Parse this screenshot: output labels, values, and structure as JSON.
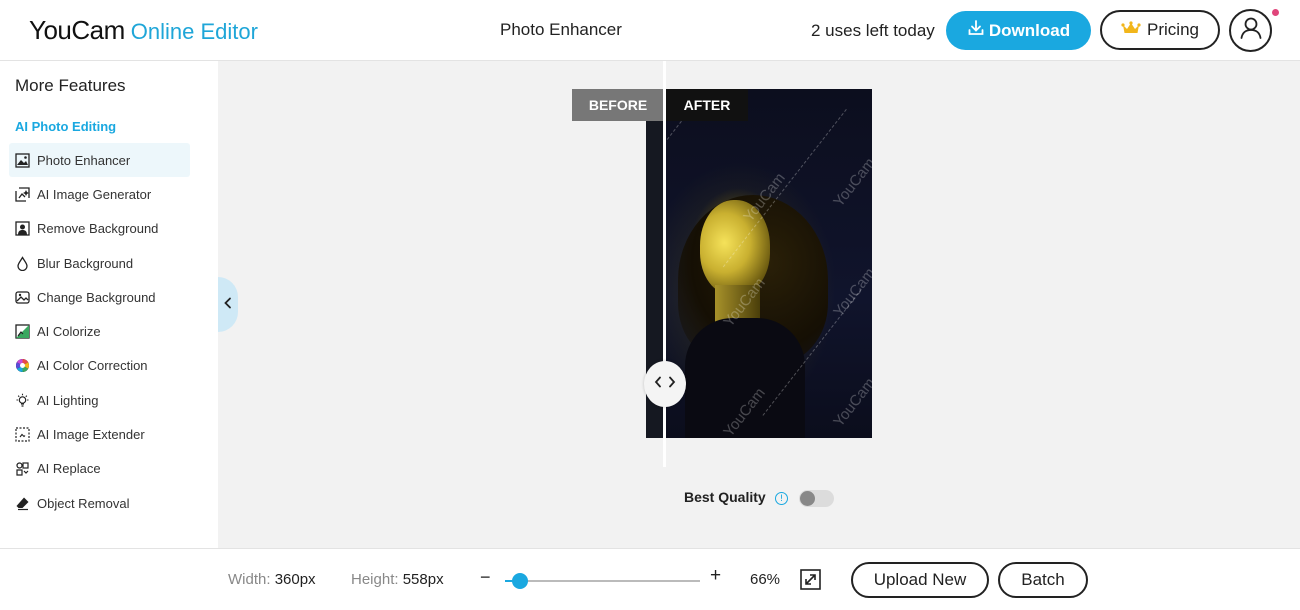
{
  "header": {
    "logo_brand": "YouCam",
    "logo_product": "Online Editor",
    "page_title": "Photo Enhancer",
    "uses_left": "2 uses left today",
    "download_label": "Download",
    "pricing_label": "Pricing",
    "notification_dot_color": "#e0457b"
  },
  "sidebar": {
    "title": "More Features",
    "section_label": "AI Photo Editing",
    "items": [
      {
        "label": "Photo Enhancer",
        "icon": "image-icon",
        "active": true
      },
      {
        "label": "AI Image Generator",
        "icon": "image-generator-icon",
        "active": false
      },
      {
        "label": "Remove Background",
        "icon": "remove-background-icon",
        "active": false
      },
      {
        "label": "Blur Background",
        "icon": "droplet-icon",
        "active": false
      },
      {
        "label": "Change Background",
        "icon": "landscape-icon",
        "active": false
      },
      {
        "label": "AI Colorize",
        "icon": "colorize-icon",
        "active": false
      },
      {
        "label": "AI Color Correction",
        "icon": "color-wheel-icon",
        "active": false
      },
      {
        "label": "AI Lighting",
        "icon": "light-bulb-icon",
        "active": false
      },
      {
        "label": "AI Image Extender",
        "icon": "expand-frame-icon",
        "active": false
      },
      {
        "label": "AI Replace",
        "icon": "replace-icon",
        "active": false
      },
      {
        "label": "Object Removal",
        "icon": "eraser-icon",
        "active": false
      }
    ]
  },
  "canvas": {
    "before_label": "BEFORE",
    "after_label": "AFTER",
    "watermark_text": "YouCam",
    "best_quality_label": "Best Quality",
    "best_quality_enabled": false
  },
  "footer": {
    "width_label": "Width:",
    "width_value": "360px",
    "height_label": "Height:",
    "height_value": "558px",
    "zoom_minus": "−",
    "zoom_plus": "+",
    "zoom_percent": 66,
    "zoom_value": "66%",
    "upload_label": "Upload New",
    "batch_label": "Batch"
  },
  "colors": {
    "accent": "#1aa8e0",
    "canvas_bg": "#f2f2f2"
  }
}
